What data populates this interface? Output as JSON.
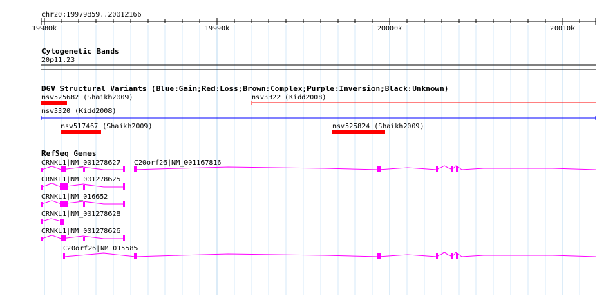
{
  "header": {
    "region": "chr20:19979859..20012166"
  },
  "ruler": {
    "ticks": [
      {
        "label": "19980k",
        "pos": 19980000
      },
      {
        "label": "19990k",
        "pos": 19990000
      },
      {
        "label": "20000k",
        "pos": 20000000
      },
      {
        "label": "20010k",
        "pos": 20010000
      }
    ]
  },
  "tracks": {
    "cytoband": {
      "title": "Cytogenetic Bands",
      "band": "20p11.23"
    },
    "dgv": {
      "title": "DGV Structural Variants (Blue:Gain;Red:Loss;Brown:Complex;Purple:Inversion;Black:Unknown)",
      "features": [
        {
          "label": "nsv525682 (Shaikh2009)",
          "color": "#ff0000"
        },
        {
          "label": "nsv3322 (Kidd2008)",
          "color": "#ff0000"
        },
        {
          "label": "nsv3320 (Kidd2008)",
          "color": "#0000ff"
        },
        {
          "label": "nsv517467 (Shaikh2009)",
          "color": "#ff0000"
        },
        {
          "label": "nsv525824 (Shaikh2009)",
          "color": "#ff0000"
        }
      ]
    },
    "refseq": {
      "title": "RefSeq Genes",
      "color": "#ff00ff",
      "genes": [
        {
          "label": "CRNKL1|NM_001278627"
        },
        {
          "label": "C20orf26|NM_001167816"
        },
        {
          "label": "CRNKL1|NM_001278625"
        },
        {
          "label": "CRNKL1|NM_016652"
        },
        {
          "label": "CRNKL1|NM_001278628"
        },
        {
          "label": "CRNKL1|NM_001278626"
        },
        {
          "label": "C20orf26|NM_015585"
        }
      ]
    }
  }
}
